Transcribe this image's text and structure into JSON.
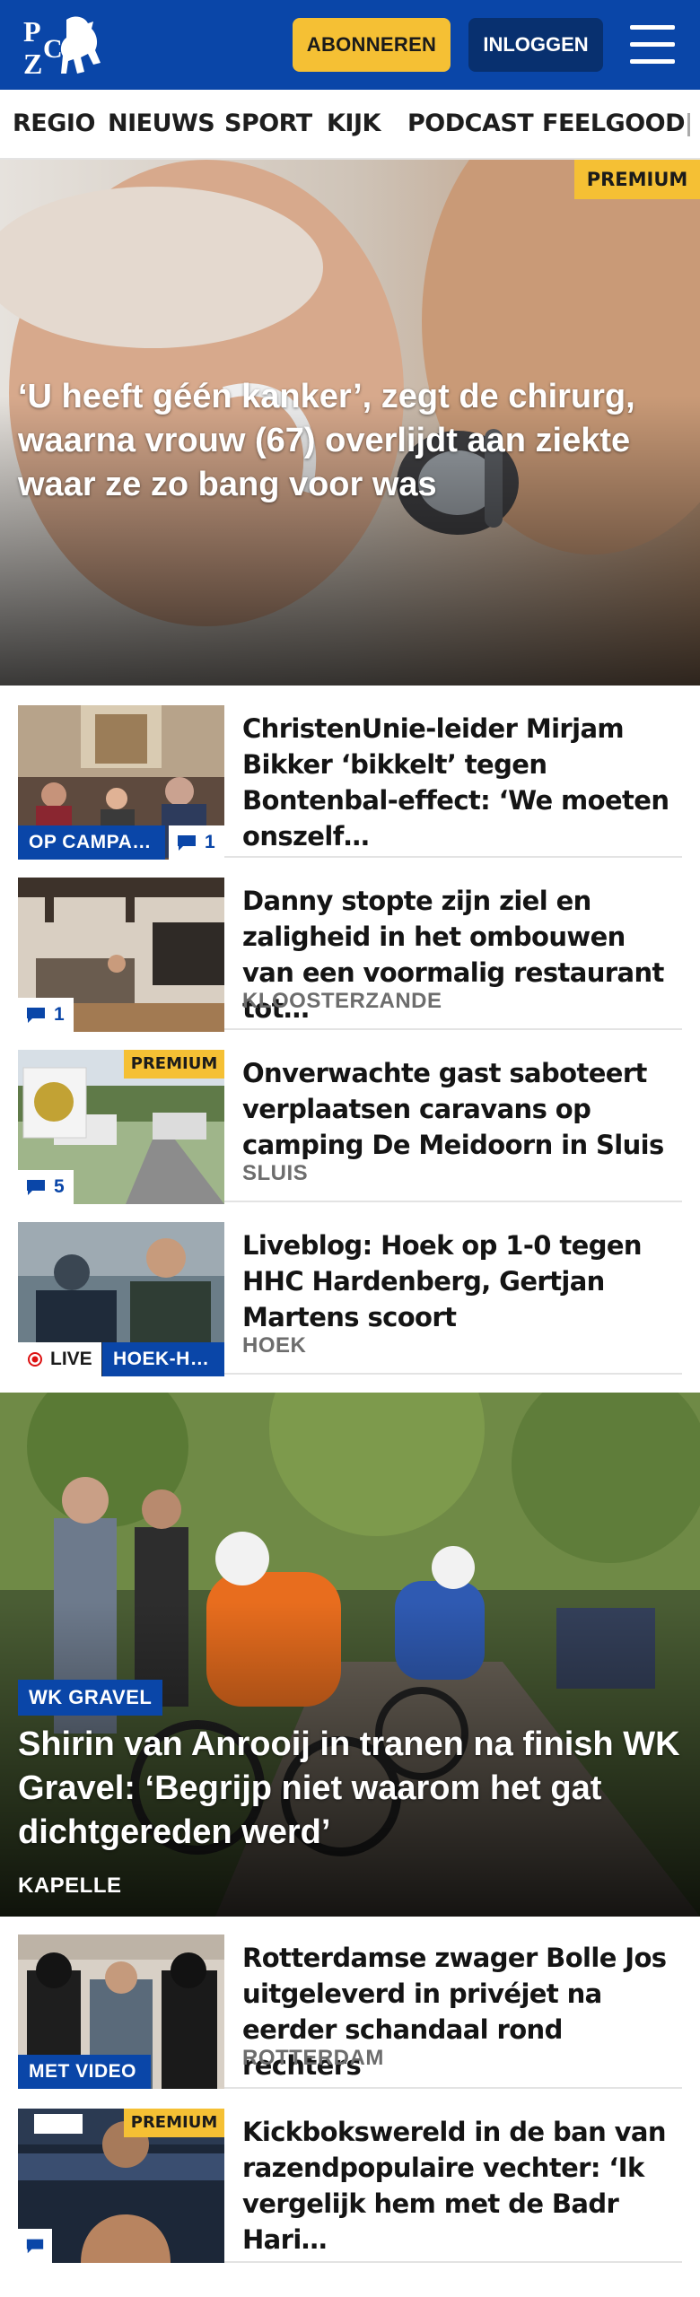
{
  "header": {
    "logo_text": "PZC",
    "subscribe_label": "ABONNEREN",
    "login_label": "INLOGGEN",
    "menu_icon": "hamburger-menu-icon",
    "brand_color": "#0a46a8",
    "accent_color": "#f5c034"
  },
  "nav": {
    "items": [
      "REGIO",
      "NIEUWS",
      "SPORT",
      "KIJK",
      "PODCAST",
      "FEELGOOD"
    ]
  },
  "hero": {
    "badge": "PREMIUM",
    "title": "‘U heeft géén kanker’, zegt de chirurg, waarna vrouw (67) overlijdt aan ziekte waar ze zo bang voor was"
  },
  "articles": [
    {
      "title": "ChristenUnie-leider Mirjam Bikker ‘bikkelt’ tegen Bontenbal-effect: ‘We moeten onszelf…",
      "tag": "OP CAMPA…",
      "comments": "1"
    },
    {
      "title": "Danny stopte zijn ziel en zaligheid in het ombouwen van een voormalig restaurant tot…",
      "location": "KLOOSTERZANDE",
      "comments": "1"
    },
    {
      "title": "Onverwachte gast saboteert verplaatsen caravans op camping De Meidoorn in Sluis",
      "location": "SLUIS",
      "badge": "PREMIUM",
      "comments": "5"
    },
    {
      "title": "Liveblog: Hoek op 1-0 tegen HHC Hardenberg, Gertjan Martens scoort",
      "location": "HOEK",
      "live_label": "LIVE",
      "tag": "HOEK-H…"
    }
  ],
  "feature": {
    "tag": "WK GRAVEL",
    "title": "Shirin van Anrooij in tranen na finish WK Gravel: ‘Begrijp niet waarom het gat dichtgereden werd’",
    "location": "KAPELLE"
  },
  "articles2": [
    {
      "title": "Rotterdamse zwager Bolle Jos uitgeleverd in privéjet na eerder schandaal rond rechters",
      "location": "ROTTERDAM",
      "tag": "MET VIDEO"
    },
    {
      "title": "Kickbokswereld in de ban van razendpopulaire vechter: ‘Ik vergelijk hem met de Badr Hari…",
      "badge": "PREMIUM"
    }
  ]
}
